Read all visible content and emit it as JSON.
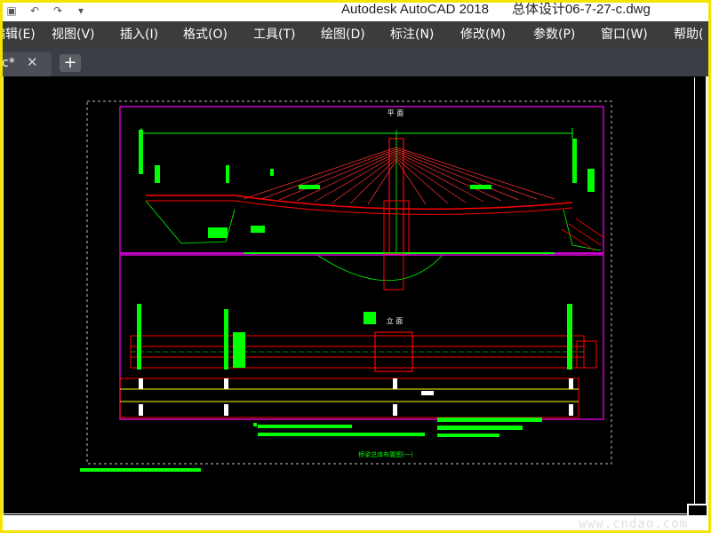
{
  "title": {
    "app_name": "Autodesk AutoCAD 2018",
    "file_name": "总体设计06-7-27-c.dwg"
  },
  "quick_access": [
    {
      "icon": "save-icon"
    },
    {
      "icon": "undo-icon"
    },
    {
      "icon": "redo-icon"
    },
    {
      "icon": "dropdown-icon"
    }
  ],
  "menu": {
    "items": [
      "编辑(E)",
      "视图(V)",
      "插入(I)",
      "格式(O)",
      "工具(T)",
      "绘图(D)",
      "标注(N)",
      "修改(M)",
      "参数(P)",
      "窗口(W)",
      "帮助("
    ]
  },
  "tabs": {
    "doc_label": "c*",
    "close_glyph": "✕",
    "new_glyph": "+"
  },
  "drawing": {
    "plan_heading": "平 面",
    "elevation_heading": "立 面",
    "footer_caption": "桥梁总体布置图(一)",
    "colors": {
      "background": "#000000",
      "frame_magenta": "#d000d0",
      "line_red": "#ff0000",
      "line_green": "#00ff00",
      "dashed_border": "#bbbbbb"
    }
  },
  "watermark": "www.cndao.com"
}
